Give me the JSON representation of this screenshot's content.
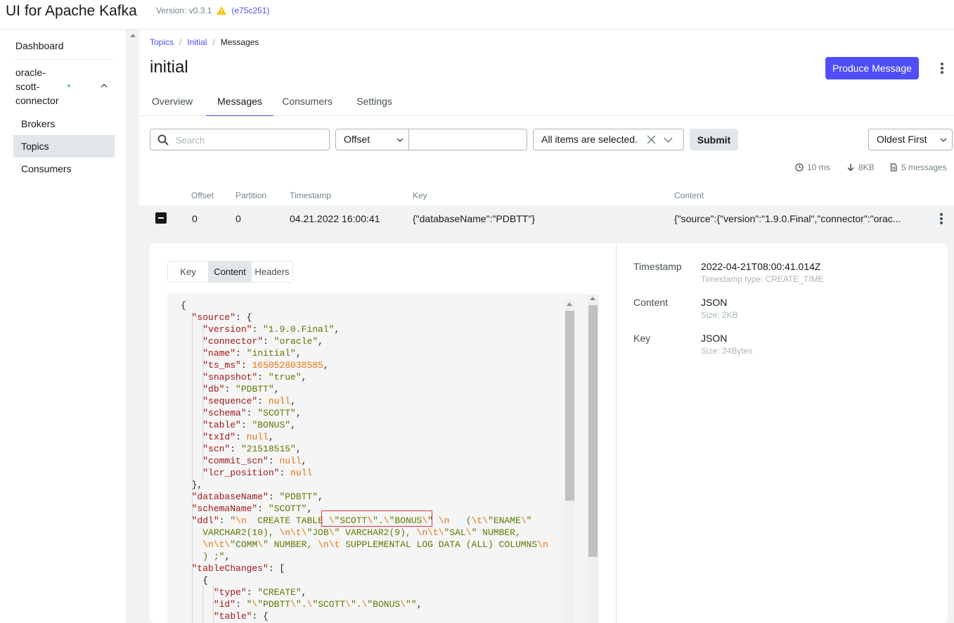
{
  "header": {
    "app_title": "UI for Apache Kafka",
    "version_label": "Version: v0.3.1",
    "commit": "(e75c251)"
  },
  "sidebar": {
    "dashboard": "Dashboard",
    "cluster_name": "oracle-scott-connector",
    "cluster_lines": [
      "oracle-",
      "scott-",
      "connector"
    ],
    "items": [
      {
        "label": "Brokers",
        "active": false
      },
      {
        "label": "Topics",
        "active": true
      },
      {
        "label": "Consumers",
        "active": false
      }
    ]
  },
  "breadcrumb": {
    "items": [
      "Topics",
      "Initial"
    ],
    "current": "Messages"
  },
  "page": {
    "title": "initial",
    "produce_button": "Produce Message"
  },
  "tabs": [
    {
      "label": "Overview",
      "active": false
    },
    {
      "label": "Messages",
      "active": true
    },
    {
      "label": "Consumers",
      "active": false
    },
    {
      "label": "Settings",
      "active": false
    }
  ],
  "filters": {
    "search_placeholder": "Search",
    "seek_type": "Offset",
    "offset_value": "",
    "partitions": "All items are selected.",
    "submit": "Submit",
    "sort": "Oldest First"
  },
  "stats": {
    "time": "10 ms",
    "size": "8KB",
    "count": "5 messages"
  },
  "table": {
    "columns": [
      "Offset",
      "Partition",
      "Timestamp",
      "Key",
      "Content"
    ],
    "rows": [
      {
        "offset": "0",
        "partition": "0",
        "timestamp": "04.21.2022 16:00:41",
        "key": "{\"databaseName\":\"PDBTT\"}",
        "content": "{\"source\":{\"version\":\"1.9.0.Final\",\"connector\":\"orac..."
      }
    ]
  },
  "detail": {
    "tabs": [
      "Key",
      "Content",
      "Headers"
    ],
    "active_tab": "Content",
    "meta": [
      {
        "label": "Timestamp",
        "value": "2022-04-21T08:00:41.014Z",
        "sub": "Timestamp type: CREATE_TIME"
      },
      {
        "label": "Content",
        "value": "JSON",
        "sub": "Size: 2KB"
      },
      {
        "label": "Key",
        "value": "JSON",
        "sub": "Size: 24Bytes"
      }
    ],
    "json_lines": [
      [
        [
          "p",
          "{"
        ]
      ],
      [
        [
          "i",
          "  "
        ],
        [
          "k",
          "\"source\""
        ],
        [
          "p",
          ": {"
        ]
      ],
      [
        [
          "i",
          "    "
        ],
        [
          "k",
          "\"version\""
        ],
        [
          "p",
          ": "
        ],
        [
          "s",
          "\"1.9.0.Final\""
        ],
        [
          "p",
          ","
        ]
      ],
      [
        [
          "i",
          "    "
        ],
        [
          "k",
          "\"connector\""
        ],
        [
          "p",
          ": "
        ],
        [
          "s",
          "\"oracle\""
        ],
        [
          "p",
          ","
        ]
      ],
      [
        [
          "i",
          "    "
        ],
        [
          "k",
          "\"name\""
        ],
        [
          "p",
          ": "
        ],
        [
          "s",
          "\"initial\""
        ],
        [
          "p",
          ","
        ]
      ],
      [
        [
          "i",
          "    "
        ],
        [
          "k",
          "\"ts_ms\""
        ],
        [
          "p",
          ": "
        ],
        [
          "n",
          "1650528038585"
        ],
        [
          "p",
          ","
        ]
      ],
      [
        [
          "i",
          "    "
        ],
        [
          "k",
          "\"snapshot\""
        ],
        [
          "p",
          ": "
        ],
        [
          "s",
          "\"true\""
        ],
        [
          "p",
          ","
        ]
      ],
      [
        [
          "i",
          "    "
        ],
        [
          "k",
          "\"db\""
        ],
        [
          "p",
          ": "
        ],
        [
          "s",
          "\"PDBTT\""
        ],
        [
          "p",
          ","
        ]
      ],
      [
        [
          "i",
          "    "
        ],
        [
          "k",
          "\"sequence\""
        ],
        [
          "p",
          ": "
        ],
        [
          "u",
          "null"
        ],
        [
          "p",
          ","
        ]
      ],
      [
        [
          "i",
          "    "
        ],
        [
          "k",
          "\"schema\""
        ],
        [
          "p",
          ": "
        ],
        [
          "s",
          "\"SCOTT\""
        ],
        [
          "p",
          ","
        ]
      ],
      [
        [
          "i",
          "    "
        ],
        [
          "k",
          "\"table\""
        ],
        [
          "p",
          ": "
        ],
        [
          "s",
          "\"BONUS\""
        ],
        [
          "p",
          ","
        ]
      ],
      [
        [
          "i",
          "    "
        ],
        [
          "k",
          "\"txId\""
        ],
        [
          "p",
          ": "
        ],
        [
          "u",
          "null"
        ],
        [
          "p",
          ","
        ]
      ],
      [
        [
          "i",
          "    "
        ],
        [
          "k",
          "\"scn\""
        ],
        [
          "p",
          ": "
        ],
        [
          "s",
          "\"21518515\""
        ],
        [
          "p",
          ","
        ]
      ],
      [
        [
          "i",
          "    "
        ],
        [
          "k",
          "\"commit_scn\""
        ],
        [
          "p",
          ": "
        ],
        [
          "u",
          "null"
        ],
        [
          "p",
          ","
        ]
      ],
      [
        [
          "i",
          "    "
        ],
        [
          "k",
          "\"lcr_position\""
        ],
        [
          "p",
          ": "
        ],
        [
          "u",
          "null"
        ]
      ],
      [
        [
          "i",
          "  "
        ],
        [
          "p",
          "},"
        ]
      ],
      [
        [
          "i",
          "  "
        ],
        [
          "k",
          "\"databaseName\""
        ],
        [
          "p",
          ": "
        ],
        [
          "s",
          "\"PDBTT\""
        ],
        [
          "p",
          ","
        ]
      ],
      [
        [
          "i",
          "  "
        ],
        [
          "k",
          "\"schemaName\""
        ],
        [
          "p",
          ": "
        ],
        [
          "s",
          "\"SCOTT\""
        ],
        [
          "p",
          ","
        ]
      ],
      [
        [
          "i",
          "  "
        ],
        [
          "k",
          "\"ddl\""
        ],
        [
          "p",
          ": "
        ],
        [
          "s",
          "\""
        ],
        [
          "e",
          "\\n"
        ],
        [
          "s",
          "  CREATE TABLE "
        ],
        [
          "e",
          "\\"
        ],
        [
          "s",
          "\"SCOTT"
        ],
        [
          "e",
          "\\"
        ],
        [
          "s",
          "\"."
        ],
        [
          "e",
          "\\"
        ],
        [
          "s",
          "\"BONUS"
        ],
        [
          "e",
          "\\"
        ],
        [
          "s",
          "\" "
        ],
        [
          "e",
          "\\n"
        ],
        [
          "s",
          "   ("
        ],
        [
          "e",
          "\\t\\"
        ],
        [
          "s",
          "\"ENAME"
        ],
        [
          "e",
          "\\"
        ],
        [
          "s",
          "\""
        ]
      ],
      [
        [
          "i",
          "    "
        ],
        [
          "s",
          "VARCHAR2(10), "
        ],
        [
          "e",
          "\\n\\t\\"
        ],
        [
          "s",
          "\"JOB"
        ],
        [
          "e",
          "\\"
        ],
        [
          "s",
          "\" VARCHAR2(9), "
        ],
        [
          "e",
          "\\n\\t\\"
        ],
        [
          "s",
          "\"SAL"
        ],
        [
          "e",
          "\\"
        ],
        [
          "s",
          "\" NUMBER,"
        ]
      ],
      [
        [
          "i",
          "    "
        ],
        [
          "e",
          "\\n\\t\\"
        ],
        [
          "s",
          "\"COMM"
        ],
        [
          "e",
          "\\"
        ],
        [
          "s",
          "\" NUMBER, "
        ],
        [
          "e",
          "\\n\\t"
        ],
        [
          "s",
          " SUPPLEMENTAL LOG DATA (ALL) COLUMNS"
        ],
        [
          "e",
          "\\n"
        ]
      ],
      [
        [
          "i",
          "    "
        ],
        [
          "s",
          ") ;\""
        ],
        [
          "p",
          ","
        ]
      ],
      [
        [
          "i",
          "  "
        ],
        [
          "k",
          "\"tableChanges\""
        ],
        [
          "p",
          ": ["
        ]
      ],
      [
        [
          "i",
          "    "
        ],
        [
          "p",
          "{"
        ]
      ],
      [
        [
          "i",
          "      "
        ],
        [
          "k",
          "\"type\""
        ],
        [
          "p",
          ": "
        ],
        [
          "s",
          "\"CREATE\""
        ],
        [
          "p",
          ","
        ]
      ],
      [
        [
          "i",
          "      "
        ],
        [
          "k",
          "\"id\""
        ],
        [
          "p",
          ": "
        ],
        [
          "s",
          "\""
        ],
        [
          "e",
          "\\"
        ],
        [
          "s",
          "\"PDBTT"
        ],
        [
          "e",
          "\\"
        ],
        [
          "s",
          "\"."
        ],
        [
          "e",
          "\\"
        ],
        [
          "s",
          "\"SCOTT"
        ],
        [
          "e",
          "\\"
        ],
        [
          "s",
          "\"."
        ],
        [
          "e",
          "\\"
        ],
        [
          "s",
          "\"BONUS"
        ],
        [
          "e",
          "\\"
        ],
        [
          "s",
          "\"\""
        ],
        [
          "p",
          ","
        ]
      ],
      [
        [
          "i",
          "      "
        ],
        [
          "k",
          "\"table\""
        ],
        [
          "p",
          ": {"
        ]
      ]
    ]
  }
}
